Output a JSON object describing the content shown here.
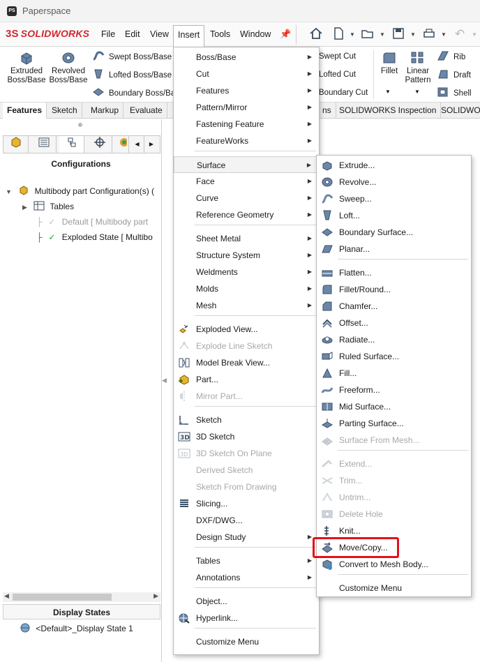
{
  "window": {
    "title": "Paperspace",
    "app_icon_text": "PS"
  },
  "app": {
    "logo_ds": "3S",
    "logo_text": "SOLIDWORKS",
    "brand_color": "#d0282e",
    "accent_highlight": "#e3111b"
  },
  "menubar": [
    "File",
    "Edit",
    "View",
    "Insert",
    "Tools",
    "Window"
  ],
  "features_toolbar": {
    "extruded": "Extruded Boss/Base",
    "revolved": "Revolved Boss/Base",
    "swept_boss": "Swept Boss/Base",
    "lofted_boss": "Lofted Boss/Base",
    "boundary_boss": "Boundary Boss/Ba",
    "swept_cut": "Swept Cut",
    "lofted_cut": "Lofted Cut",
    "boundary_cut": "Boundary Cut",
    "fillet": "Fillet",
    "linear_pattern": "Linear Pattern",
    "rib": "Rib",
    "draft": "Draft",
    "shell": "Shell"
  },
  "tabs": [
    "Features",
    "Sketch",
    "Markup",
    "Evaluate",
    "ns",
    "SOLIDWORKS Inspection",
    "SOLIDWO"
  ],
  "left_panel": {
    "config_header": "Configurations",
    "tree": {
      "root": "Multibody part Configuration(s)  (",
      "tables": "Tables",
      "default": "Default [ Multibody part",
      "exploded": "Exploded State [ Multibo"
    },
    "display_states_header": "Display States",
    "display_state_item": "<Default>_Display State 1"
  },
  "insert_menu": {
    "items": [
      {
        "label": "Boss/Base",
        "sub": true
      },
      {
        "label": "Cut",
        "sub": true
      },
      {
        "label": "Features",
        "sub": true
      },
      {
        "label": "Pattern/Mirror",
        "sub": true
      },
      {
        "label": "Fastening Feature",
        "sub": true
      },
      {
        "label": "FeatureWorks",
        "sub": true
      },
      {
        "label": "Surface",
        "sub": true
      },
      {
        "label": "Face",
        "sub": true
      },
      {
        "label": "Curve",
        "sub": true
      },
      {
        "label": "Reference Geometry",
        "sub": true
      },
      {
        "label": "Sheet Metal",
        "sub": true
      },
      {
        "label": "Structure System",
        "sub": true
      },
      {
        "label": "Weldments",
        "sub": true
      },
      {
        "label": "Molds",
        "sub": true
      },
      {
        "label": "Mesh",
        "sub": true
      },
      {
        "label": "Exploded View...",
        "sub": false
      },
      {
        "label": "Explode Line Sketch",
        "sub": false
      },
      {
        "label": "Model Break View...",
        "sub": false
      },
      {
        "label": "Part...",
        "sub": false
      },
      {
        "label": "Mirror Part...",
        "sub": false
      },
      {
        "label": "Sketch",
        "sub": false
      },
      {
        "label": "3D Sketch",
        "sub": false
      },
      {
        "label": "3D Sketch On Plane",
        "sub": false
      },
      {
        "label": "Derived Sketch",
        "sub": false
      },
      {
        "label": "Sketch From Drawing",
        "sub": false
      },
      {
        "label": "Slicing...",
        "sub": false
      },
      {
        "label": "DXF/DWG...",
        "sub": false
      },
      {
        "label": "Design Study",
        "sub": true
      },
      {
        "label": "Tables",
        "sub": true
      },
      {
        "label": "Annotations",
        "sub": true
      },
      {
        "label": "Object...",
        "sub": false
      },
      {
        "label": "Hyperlink...",
        "sub": false
      },
      {
        "label": "Customize Menu",
        "sub": false
      }
    ]
  },
  "surface_menu": {
    "items": [
      {
        "label": "Extrude..."
      },
      {
        "label": "Revolve..."
      },
      {
        "label": "Sweep..."
      },
      {
        "label": "Loft..."
      },
      {
        "label": "Boundary Surface..."
      },
      {
        "label": "Planar..."
      },
      {
        "label": "Flatten..."
      },
      {
        "label": "Fillet/Round..."
      },
      {
        "label": "Chamfer..."
      },
      {
        "label": "Offset..."
      },
      {
        "label": "Radiate..."
      },
      {
        "label": "Ruled Surface..."
      },
      {
        "label": "Fill..."
      },
      {
        "label": "Freeform..."
      },
      {
        "label": "Mid Surface..."
      },
      {
        "label": "Parting Surface..."
      },
      {
        "label": "Surface From Mesh..."
      },
      {
        "label": "Extend..."
      },
      {
        "label": "Trim..."
      },
      {
        "label": "Untrim..."
      },
      {
        "label": "Delete Hole"
      },
      {
        "label": "Knit..."
      },
      {
        "label": "Move/Copy..."
      },
      {
        "label": "Convert to Mesh Body..."
      },
      {
        "label": "Customize Menu"
      }
    ]
  }
}
